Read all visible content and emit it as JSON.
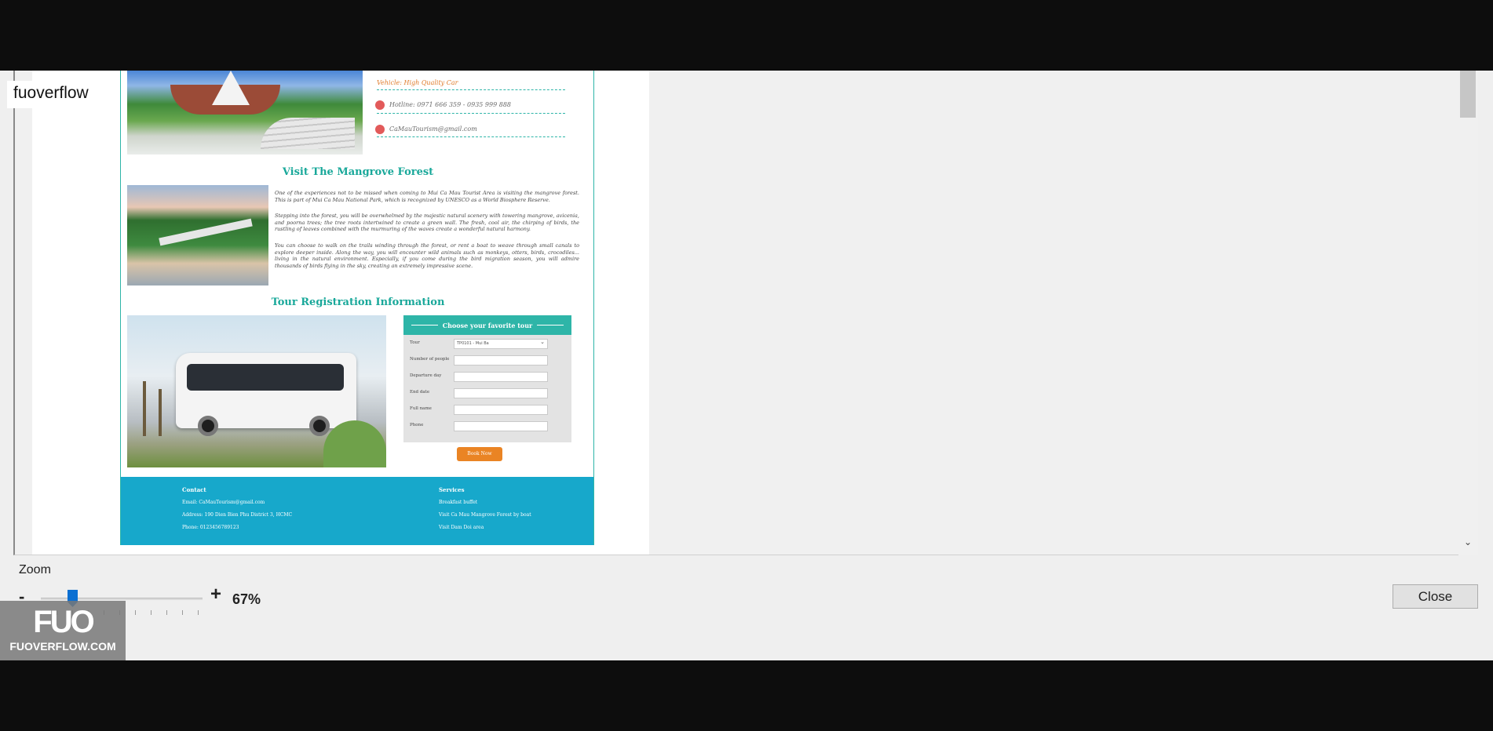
{
  "watermark": {
    "text": "fuoverflow",
    "logo": "FUO",
    "site": "FUOVERFLOW.COM"
  },
  "preview": {
    "contact": {
      "vehicle": "Vehicle: High Quality Car",
      "hotline": "Hotline: 0971 666 359 - 0935 999 888",
      "email": "CaMauTourism@gmail.com"
    },
    "mangrove": {
      "title": "Visit The Mangrove Forest",
      "p1": "One of the experiences not to be missed when coming to Mui Ca Mau Tourist Area is visiting the mangrove forest. This is part of Mui Ca Mau National Park, which is recognized by UNESCO as a World Biosphere Reserve.",
      "p2": "Stepping into the forest, you will be overwhelmed by the majestic natural scenery with towering mangrove, avicenia, and poorna trees; the tree roots intertwined to create a green wall. The fresh, cool air, the chirping of birds, the rustling of leaves combined with the murmuring of the waves create a wonderful natural harmony.",
      "p3": "You can choose to walk on the trails winding through the forest, or rent a boat to weave through small canals to explore deeper inside. Along the way, you will encounter wild animals such as monkeys, otters, birds, crocodiles... living in the natural environment. Especially, if you come during the bird migration season, you will admire thousands of birds flying in the sky, creating an extremely impressive scene."
    },
    "registration": {
      "title": "Tour Registration Information",
      "form_title": "Choose your favorite tour",
      "fields": [
        {
          "label": "Tour",
          "value": "TP0101 - Mui Ba"
        },
        {
          "label": "Number of people",
          "value": ""
        },
        {
          "label": "Departure day",
          "value": ""
        },
        {
          "label": "End date",
          "value": ""
        },
        {
          "label": "Full name",
          "value": ""
        },
        {
          "label": "Phone",
          "value": ""
        }
      ],
      "button": "Book Now"
    },
    "footer": {
      "contact_title": "Contact",
      "contact_lines": [
        "Email: CaMauTourism@gmail.com",
        "Address: 190 Dien Bien Phu District 3, HCMC",
        "Phone: 0123456789123"
      ],
      "services_title": "Services",
      "services_lines": [
        "Breakfast buffet",
        "Visit Ca Mau Mangrove Forest by boat",
        "Visit Dam Doi area"
      ]
    }
  },
  "controls": {
    "zoom_label": "Zoom",
    "minus": "-",
    "plus": "+",
    "zoom_value": "67%",
    "zoom_percent": 67,
    "close": "Close",
    "scroll_down_icon": "chevron-down-icon"
  }
}
